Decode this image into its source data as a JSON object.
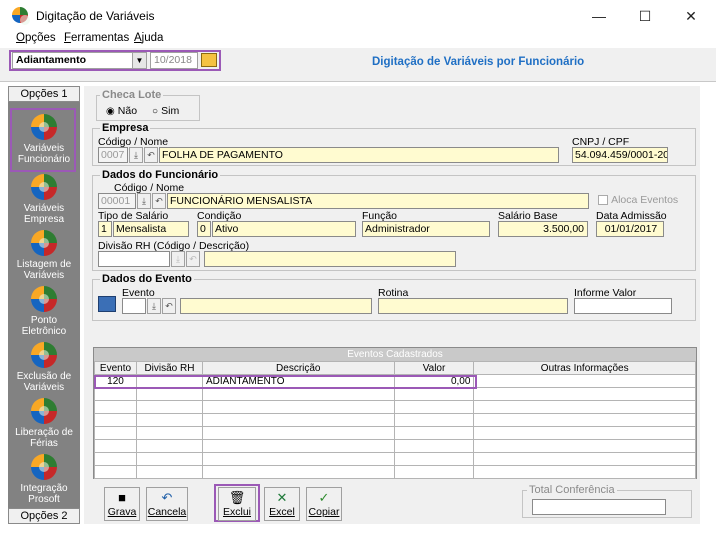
{
  "window": {
    "title": "Digitação de Variáveis",
    "minimize": "—",
    "maximize": "☐",
    "close": "✕"
  },
  "menu": [
    "Opções",
    "Ferramentas",
    "Ajuda"
  ],
  "toolbar": {
    "type_value": "Adiantamento",
    "period_value": "10/2018",
    "page_title": "Digitação de Variáveis por Funcionário"
  },
  "sidebar": {
    "tab_top": "Opções 1",
    "tab_bottom": "Opções 2",
    "items": [
      {
        "label": "Variáveis Funcionário"
      },
      {
        "label": "Variáveis Empresa"
      },
      {
        "label": "Listagem de Variáveis"
      },
      {
        "label": "Ponto Eletrônico"
      },
      {
        "label": "Exclusão de Variáveis"
      },
      {
        "label": "Liberação de Férias"
      },
      {
        "label": "Integração Prosoft"
      }
    ]
  },
  "checa_lote": {
    "title": "Checa Lote",
    "opt_nao": "Não",
    "opt_sim": "Sim",
    "selected": "Não"
  },
  "empresa": {
    "title": "Empresa",
    "code_label": "Código / Nome",
    "code": "0007",
    "name": "FOLHA DE PAGAMENTO",
    "cnpj_label": "CNPJ / CPF",
    "cnpj": "54.094.459/0001-20"
  },
  "funcionario": {
    "title": "Dados do Funcionário",
    "code_label": "Código / Nome",
    "code": "00001",
    "name": "FUNCIONÁRIO MENSALISTA",
    "aloca_label": "Aloca Eventos",
    "tipo_label": "Tipo de Salário",
    "tipo_code": "1",
    "tipo": "Mensalista",
    "condicao_label": "Condição",
    "condicao_code": "0",
    "condicao": "Ativo",
    "funcao_label": "Função",
    "funcao": "Administrador",
    "salario_label": "Salário Base",
    "salario": "3.500,00",
    "admissao_label": "Data Admissão",
    "admissao": "01/01/2017",
    "divisao_label": "Divisão RH (Código / Descrição)"
  },
  "evento": {
    "title": "Dados do Evento",
    "evento_label": "Evento",
    "rotina_label": "Rotina",
    "valor_label": "Informe Valor"
  },
  "grid": {
    "caption": "Eventos Cadastrados",
    "columns": [
      "Evento",
      "Divisão RH",
      "Descrição",
      "Valor",
      "Outras Informações"
    ],
    "rows": [
      {
        "evento": "120",
        "divisao": "",
        "descricao": "ADIANTAMENTO",
        "valor": "0,00",
        "outras": ""
      }
    ]
  },
  "buttons": {
    "grava": "Grava",
    "cancela": "Cancela",
    "exclui": "Exclui",
    "excel": "Excel",
    "copiar": "Copiar"
  },
  "total_label": "Total Conferência",
  "colors": {
    "highlight": "#9b59b6",
    "title_blue": "#1f6fc4",
    "input_yellow": "#fffbd0",
    "sidebar": "#828282"
  }
}
